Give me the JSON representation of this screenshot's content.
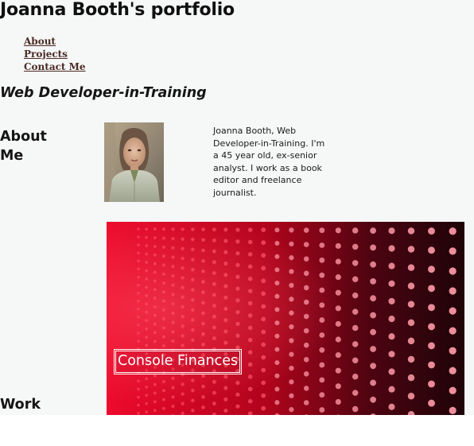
{
  "header": {
    "title": "Joanna Booth's portfolio"
  },
  "nav": {
    "items": [
      {
        "label": "About"
      },
      {
        "label": "Projects"
      },
      {
        "label": "Contact Me"
      }
    ]
  },
  "hero": {
    "tagline": "Web Developer-in-Training"
  },
  "about": {
    "heading": "About Me",
    "text": "Joanna Booth, Web Developer-in-Training. I'm a 45 year old, ex-senior analyst. I work as a book editor and freelance journalist."
  },
  "work": {
    "heading": "Work",
    "projects": [
      {
        "title": "Console Finances"
      }
    ]
  },
  "colors": {
    "page_background": "#f6f7f7",
    "nav_link": "#4a2b24",
    "project_card": "#c2061f",
    "project_label": "#ffffff"
  }
}
